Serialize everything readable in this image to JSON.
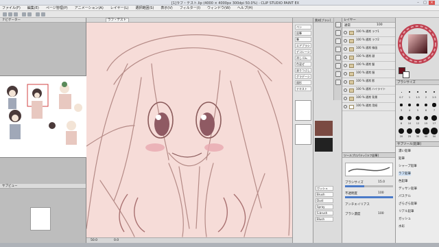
{
  "app": {
    "title": "[1]ラフ・テスト.lip (4000 × 4000px 300dpi 50.0%) - CLIP STUDIO PAINT EX"
  },
  "menu": [
    "ファイル(F)",
    "編集(E)",
    "ページ管理(P)",
    "アニメーション(A)",
    "レイヤー(L)",
    "選択範囲(S)",
    "表示(V)",
    "フィルター(I)",
    "ウィンドウ(W)",
    "ヘルプ(H)"
  ],
  "canvas_tab": {
    "label": "ラフ・テスト"
  },
  "left_panel": {
    "tab_label": "ナビゲーター",
    "tab2_label": "サブビュー"
  },
  "brush_list": {
    "tab_label": "素材[ブラシ]",
    "items": [
      "ガッシュ",
      "Brush",
      "Dust",
      "Spray",
      "S.brush",
      "Blush"
    ]
  },
  "tool_column": {
    "items": [
      "ペン",
      "鉛筆",
      "筆",
      "エアブラシ",
      "デコレーション",
      "消しゴム",
      "色混ぜ",
      "塗りつぶし",
      "グラデーション",
      "図形",
      "テキスト"
    ]
  },
  "layers": {
    "tab_label": "レイヤー",
    "blend_label": "通常",
    "opacity": "100",
    "rows": [
      {
        "name": "100 % 通常 ラフ1"
      },
      {
        "name": "100 % 通常 ラフ2"
      },
      {
        "name": "100 % 通常 線画"
      },
      {
        "name": "100 % 通常 顔"
      },
      {
        "name": "100 % 通常 髪"
      },
      {
        "name": "100 % 通常 服"
      },
      {
        "name": "100 % 通常 影"
      },
      {
        "name": "100 % 通常 ハイライト"
      },
      {
        "name": "100 % 通常 背景"
      },
      {
        "name": "100 % 通常 用紙"
      }
    ]
  },
  "tool_property": {
    "tab_label": "ツールプロパティ[ラフ鉛筆]",
    "brush_size_label": "ブラシサイズ",
    "brush_size_value": "15.0",
    "opacity_label": "不透明度",
    "opacity_value": "100",
    "anti_alias_label": "アンチエイリアス",
    "density_label": "ブラシ濃度",
    "density_value": "100"
  },
  "color": {
    "main": "#6b0f1c",
    "sub": "#ffffff"
  },
  "brush_size": {
    "tab_label": "ブラシサイズ",
    "values": [
      "0.7",
      "1",
      "1.5",
      "2",
      "2.5",
      "3",
      "4",
      "5",
      "6",
      "7",
      "8",
      "10",
      "12",
      "15",
      "17",
      "20",
      "25",
      "30",
      "40",
      "50"
    ]
  },
  "sub_tool": {
    "tab_label": "サブツール[鉛筆]",
    "items": [
      "濃い鉛筆",
      "鉛筆",
      "シャープ鉛筆",
      "ラフ鉛筆",
      "色鉛筆",
      "デッサン鉛筆",
      "パステル",
      "ざらざら鉛筆",
      "リアル鉛筆",
      "ガッシュ",
      "水彩"
    ]
  },
  "canvas_status": {
    "zoom": "50.0",
    "angle": "0.0"
  }
}
